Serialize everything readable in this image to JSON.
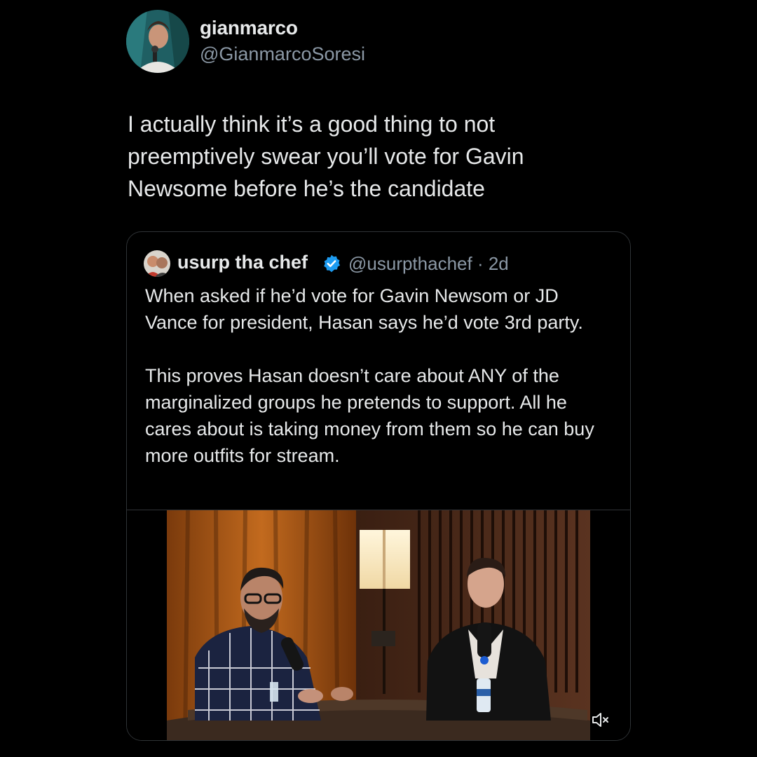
{
  "tweet": {
    "author": {
      "display_name": "gianmarco",
      "handle": "@GianmarcoSoresi"
    },
    "text": "I actually think it’s a good thing to not preemptively swear you’ll vote for Gavin Newsome before he’s the candidate"
  },
  "quote": {
    "author": {
      "display_name": "usurp tha chef",
      "verified": true,
      "handle_and_time": "@usurpthachef · 2d"
    },
    "paragraphs": [
      "When asked if he’d vote for Gavin Newsom or JD Vance for president, Hasan says he’d vote 3rd party.",
      "This proves Hasan doesn’t care about ANY of the marginalized groups he pretends to support. All he cares about is taking money from them so he can buy more outfits for stream."
    ],
    "media": {
      "type": "video",
      "muted": true,
      "icon": "muted-speaker-icon"
    }
  },
  "colors": {
    "background": "#000000",
    "text_primary": "#e7e9ea",
    "text_secondary": "#8b98a5",
    "border": "#2f3336",
    "verified_blue": "#1d9bf0"
  }
}
